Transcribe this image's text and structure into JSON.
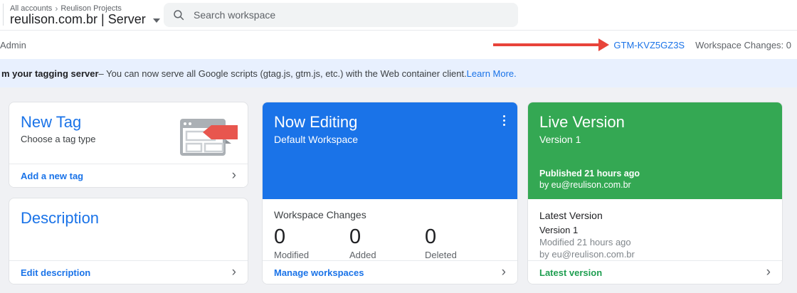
{
  "colors": {
    "blue": "#1a73e8",
    "green": "#34a853",
    "green_link": "#1e9e50",
    "arrow_red": "#e8443a",
    "tag_red": "#e8564e",
    "banner_bg": "#e8f0fe",
    "page_bg": "#f0f1f4"
  },
  "icons": {
    "chevron": "›",
    "breadcrumb_separator": "›"
  },
  "header": {
    "breadcrumb": {
      "items": [
        "All accounts",
        "Reulison Projects"
      ],
      "separator": "›"
    },
    "title": "reulison.com.br | Server",
    "search_placeholder": "Search workspace"
  },
  "tabs": {
    "admin": "Admin",
    "container_id": "GTM-KVZ5GZ3S",
    "workspace_changes": "Workspace Changes: 0"
  },
  "banner": {
    "bold": "m your tagging server",
    "text": "– You can now serve all Google scripts (gtag.js, gtm.js, etc.) with the Web container client.",
    "link": "Learn More."
  },
  "cards": {
    "new_tag": {
      "title": "New Tag",
      "subtitle": "Choose a tag type",
      "footer_label": "Add a new tag"
    },
    "description": {
      "title": "Description",
      "footer_label": "Edit description"
    },
    "now_editing": {
      "title": "Now Editing",
      "subtitle": "Default Workspace",
      "section_heading": "Workspace Changes",
      "stats": [
        {
          "value": "0",
          "label": "Modified"
        },
        {
          "value": "0",
          "label": "Added"
        },
        {
          "value": "0",
          "label": "Deleted"
        }
      ],
      "footer_label": "Manage workspaces"
    },
    "live_version": {
      "title": "Live Version",
      "subtitle": "Version 1",
      "published_line1": "Published 21 hours ago",
      "published_line2": "by eu@reulison.com.br",
      "latest_heading": "Latest Version",
      "latest_version": "Version 1",
      "latest_modified": "Modified 21 hours ago",
      "latest_by": "by eu@reulison.com.br",
      "footer_label": "Latest version"
    }
  }
}
